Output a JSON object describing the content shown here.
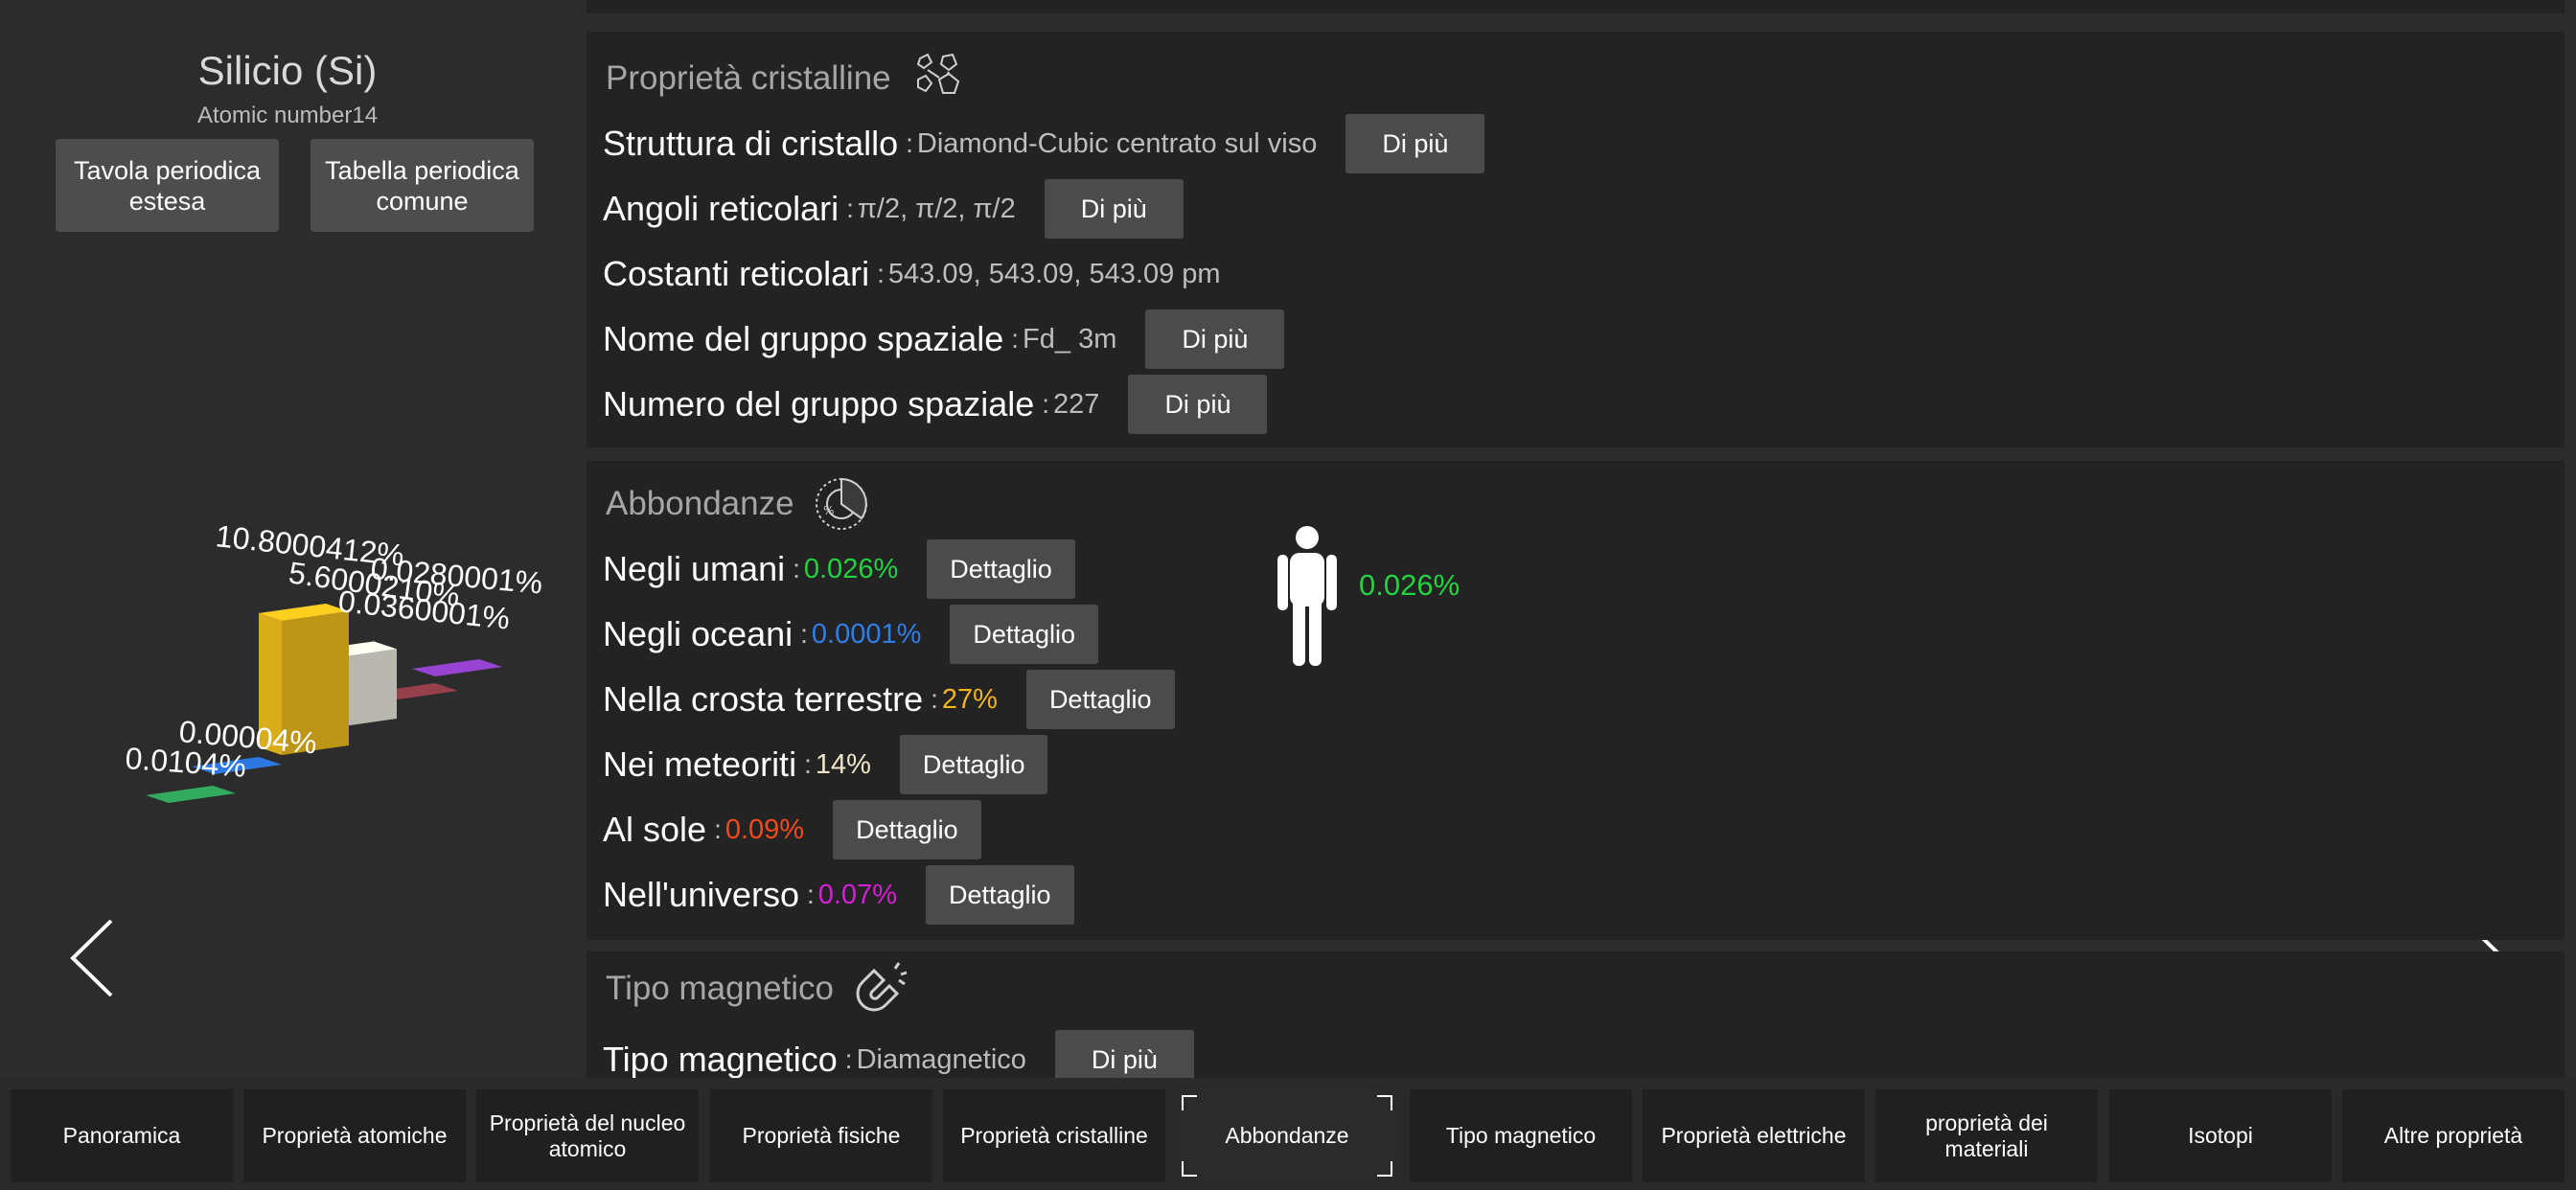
{
  "element": {
    "name": "Silicio",
    "symbol": "(Si)",
    "atomic_label": "Atomic number",
    "atomic_number": "14",
    "buttons": {
      "extended_table": "Tavola periodica estesa",
      "common_table": "Tabella periodica comune"
    }
  },
  "chart_data": {
    "type": "bar",
    "categories": [
      "Negli umani",
      "Negli oceani",
      "Nella crosta terrestre",
      "Nei meteoriti",
      "Al sole",
      "Nell'universo"
    ],
    "labels": [
      "0.0104%",
      "0.00004%",
      "10.8000412%",
      "5.6000210%",
      "0.0360001%",
      "0.0280001%"
    ],
    "values": [
      0.0104,
      4e-05,
      10.8000412,
      5.600021,
      0.0360001,
      0.0280001
    ],
    "colors": [
      "#2e9e57",
      "#2a6fd1",
      "#f2c01e",
      "#ecebe1",
      "#8a3b45",
      "#8c3fc4"
    ]
  },
  "sections": {
    "crystal": {
      "title": "Proprietà cristalline",
      "icon": "crystal-icon",
      "rows": [
        {
          "label": "Struttura di cristallo",
          "value": "Diamond-Cubic centrato sul viso",
          "button": "Di più"
        },
        {
          "label": "Angoli reticolari",
          "value": "π/2, π/2, π/2",
          "button": "Di più"
        },
        {
          "label": "Costanti reticolari",
          "value": "543.09, 543.09, 543.09 pm"
        },
        {
          "label": "Nome del gruppo spaziale",
          "value": "Fd_ 3m",
          "button": "Di più"
        },
        {
          "label": "Numero del gruppo spaziale",
          "value": "227",
          "button": "Di più"
        }
      ]
    },
    "abundance": {
      "title": "Abbondanze",
      "icon": "pie-percent-icon",
      "rows": [
        {
          "label": "Negli umani",
          "value": "0.026%",
          "color": "#22d33f",
          "button": "Dettaglio"
        },
        {
          "label": "Negli oceani",
          "value": "0.0001%",
          "color": "#2f7ee8",
          "button": "Dettaglio"
        },
        {
          "label": "Nella crosta terrestre",
          "value": "27%",
          "color": "#f2b51d",
          "button": "Dettaglio"
        },
        {
          "label": "Nei meteoriti",
          "value": "14%",
          "color": "#efe6c8",
          "button": "Dettaglio"
        },
        {
          "label": "Al sole",
          "value": "0.09%",
          "color": "#f04a1f",
          "button": "Dettaglio"
        },
        {
          "label": "Nell'universo",
          "value": "0.07%",
          "color": "#d61fd6",
          "button": "Dettaglio"
        }
      ],
      "human_value": "0.026%",
      "human_color": "#22d33f"
    },
    "magnetic": {
      "title": "Tipo magnetico",
      "icon": "magnet-icon",
      "rows": [
        {
          "label": "Tipo magnetico",
          "value": "Diamagnetico",
          "button": "Di più"
        }
      ]
    }
  },
  "separator": ":",
  "tabs": [
    {
      "label": "Panoramica"
    },
    {
      "label": "Proprietà atomiche"
    },
    {
      "label": "Proprietà del nucleo atomico"
    },
    {
      "label": "Proprietà fisiche"
    },
    {
      "label": "Proprietà cristalline"
    },
    {
      "label": "Abbondanze",
      "active": true
    },
    {
      "label": "Tipo magnetico"
    },
    {
      "label": "Proprietà elettriche"
    },
    {
      "label": "proprietà dei materiali"
    },
    {
      "label": "Isotopi"
    },
    {
      "label": "Altre proprietà"
    }
  ]
}
